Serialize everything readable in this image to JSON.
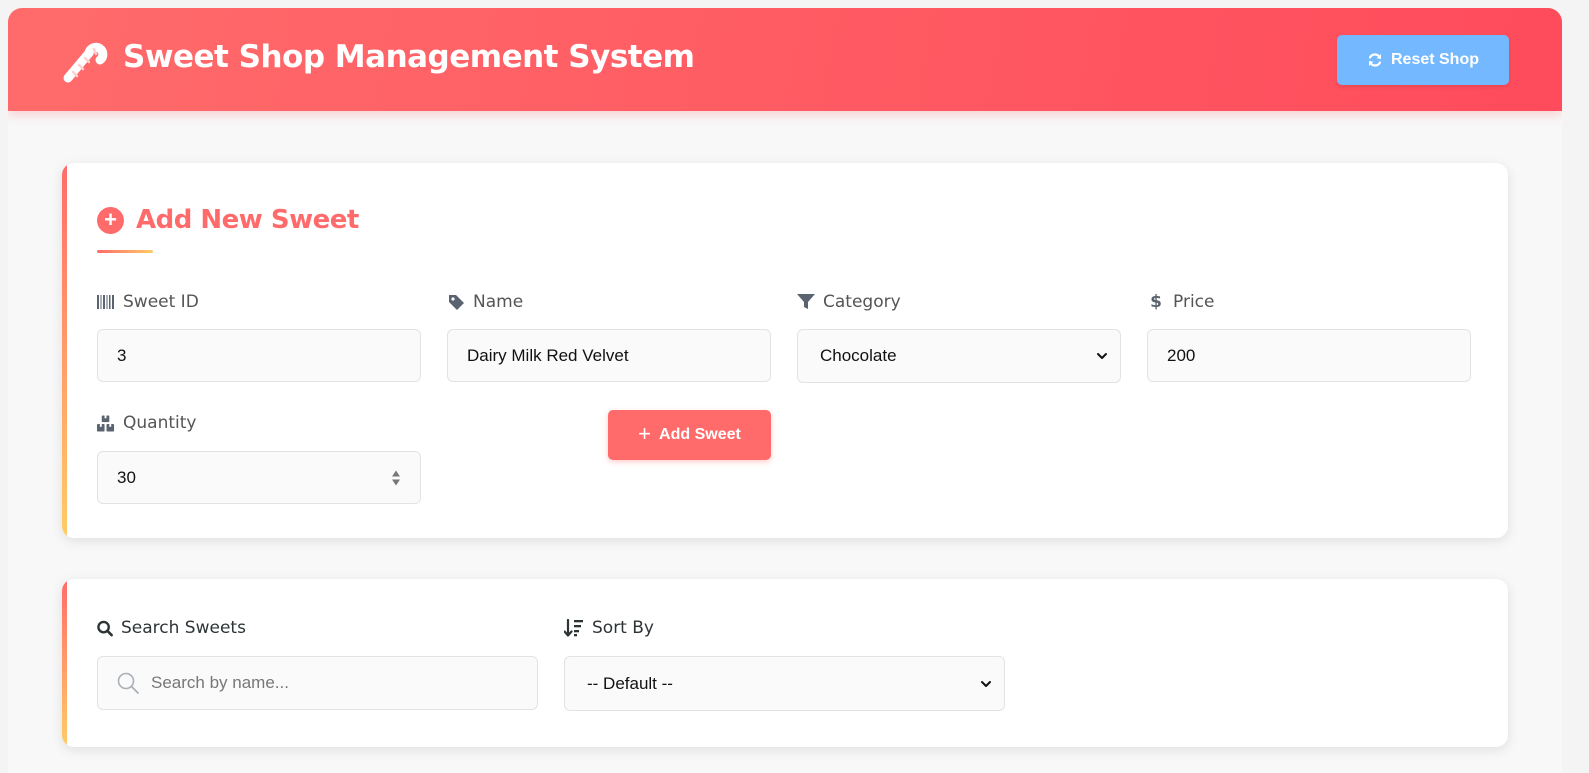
{
  "header": {
    "title": "Sweet Shop Management System",
    "reset_label": "Reset Shop",
    "brand_icon": "candy-cane-icon",
    "colors": {
      "gradient_start": "#ff6b6b",
      "gradient_end": "#ff4b5c",
      "reset_button": "#74b9ff"
    }
  },
  "add_form": {
    "title": "Add New Sweet",
    "fields": {
      "sweet_id": {
        "label": "Sweet ID",
        "value": "3",
        "icon": "barcode-icon"
      },
      "name": {
        "label": "Name",
        "value": "Dairy Milk Red Velvet",
        "icon": "tag-icon"
      },
      "category": {
        "label": "Category",
        "value": "Chocolate",
        "icon": "filter-icon"
      },
      "price": {
        "label": "Price",
        "value": "200",
        "icon": "dollar-icon"
      },
      "quantity": {
        "label": "Quantity",
        "value": "30",
        "icon": "boxes-icon"
      }
    },
    "submit_label": "Add Sweet",
    "accent": "#ff6b6b"
  },
  "search": {
    "search_label": "Search Sweets",
    "search_placeholder": "Search by name...",
    "sort_label": "Sort By",
    "sort_value": "-- Default --"
  }
}
